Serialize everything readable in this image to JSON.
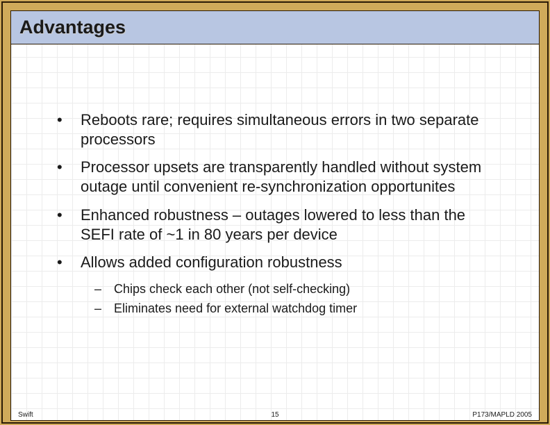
{
  "title": "Advantages",
  "bullets": [
    "Reboots rare; requires simultaneous errors in two separate processors",
    "Processor upsets are transparently handled without system outage until convenient re-synchronization opportunites",
    "Enhanced robustness – outages lowered to less than the SEFI rate of ~1 in 80 years per device",
    "Allows added configuration robustness"
  ],
  "subBullets": [
    "Chips check each other (not self-checking)",
    "Eliminates need for external watchdog timer"
  ],
  "footer": {
    "left": "Swift",
    "center": "15",
    "right": "P173/MAPLD 2005"
  }
}
